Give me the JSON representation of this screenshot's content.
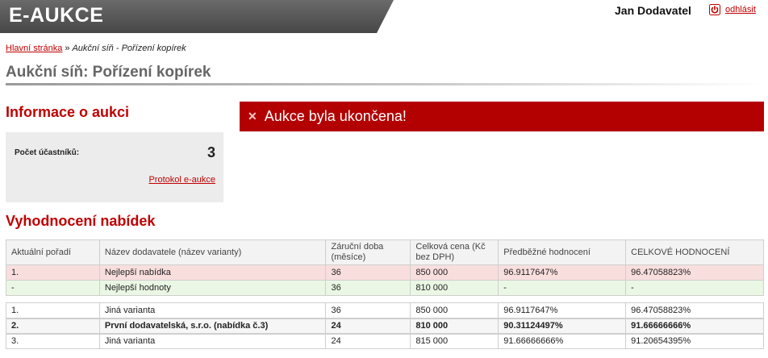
{
  "header": {
    "logo_text": "E-AUKCE",
    "user_name": "Jan Dodavatel",
    "logout_label": "odhlásit",
    "logout_icon": "power-icon",
    "accent_color": "#c00000",
    "logo_bar_color": "#555555"
  },
  "breadcrumb": {
    "home": "Hlavní stránka",
    "separator": "»",
    "current": "Aukční síň - Pořízení kopírek"
  },
  "page": {
    "title": "Aukční síň: Pořízení kopírek"
  },
  "info": {
    "heading": "Informace o aukci",
    "participants_label": "Počet účastníků:",
    "participants_value": "3",
    "protocol_link": "Protokol e-aukce"
  },
  "alert": {
    "icon": "close-icon",
    "text": "Aukce byla ukončena!",
    "color": "#b30000"
  },
  "evaluation": {
    "heading": "Vyhodnocení nabídek",
    "columns": [
      "Aktuální pořadí",
      "Název dodavatele (název varianty)",
      "Záruční doba (měsíce)",
      "Celková cena (Kč bez DPH)",
      "Předběžné hodnocení",
      "CELKOVÉ HODNOCENÍ"
    ],
    "best_offer": [
      "1.",
      "Nejlepší nabídka",
      "36",
      "850 000",
      "96.9117647%",
      "96.47058823%"
    ],
    "best_values": [
      "-",
      "Nejlepší hodnoty",
      "36",
      "810 000",
      "-",
      "-"
    ],
    "rows": [
      [
        "1.",
        "Jiná varianta",
        "36",
        "850 000",
        "96.9117647%",
        "96.47058823%"
      ],
      [
        "2.",
        "První dodavatelská, s.r.o. (nabídka č.3)",
        "24",
        "810 000",
        "90.31124497%",
        "91.66666666%"
      ],
      [
        "3.",
        "Jiná varianta",
        "24",
        "815 000",
        "91.66666666%",
        "91.20654395%"
      ]
    ]
  }
}
